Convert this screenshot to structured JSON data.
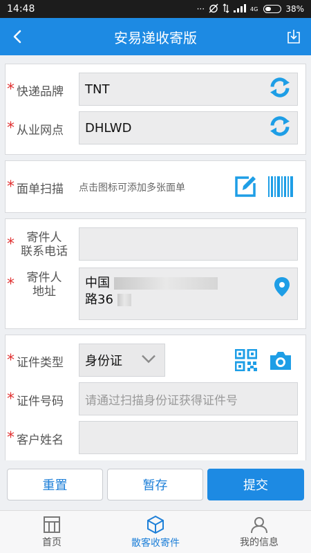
{
  "status": {
    "time": "14:48",
    "dots": "···",
    "signal_text": "4G",
    "battery": "38%"
  },
  "appbar": {
    "title": "安易递收寄版"
  },
  "express": {
    "brand_label": "快递品牌",
    "brand_value": "TNT",
    "outlet_label": "从业网点",
    "outlet_value": "DHLWD"
  },
  "waybill": {
    "label": "面单扫描",
    "hint": "点击图标可添加多张面单"
  },
  "sender": {
    "phone_label_1": "寄件人",
    "phone_label_2": "联系电话",
    "addr_label_1": "寄件人",
    "addr_label_2": "地址",
    "addr_value_1": "中国",
    "addr_value_2": "路36"
  },
  "id": {
    "type_label": "证件类型",
    "type_value": "身份证",
    "number_label": "证件号码",
    "number_placeholder": "请通过扫描身份证获得证件号",
    "name_label": "客户姓名"
  },
  "actions": {
    "reset": "重置",
    "save": "暂存",
    "submit": "提交"
  },
  "tabs": [
    {
      "label": "首页"
    },
    {
      "label": "散客收寄件"
    },
    {
      "label": "我的信息"
    }
  ],
  "colors": {
    "primary": "#1d8ae3",
    "required": "#e03131",
    "accent_icon": "#1e9ee6"
  }
}
